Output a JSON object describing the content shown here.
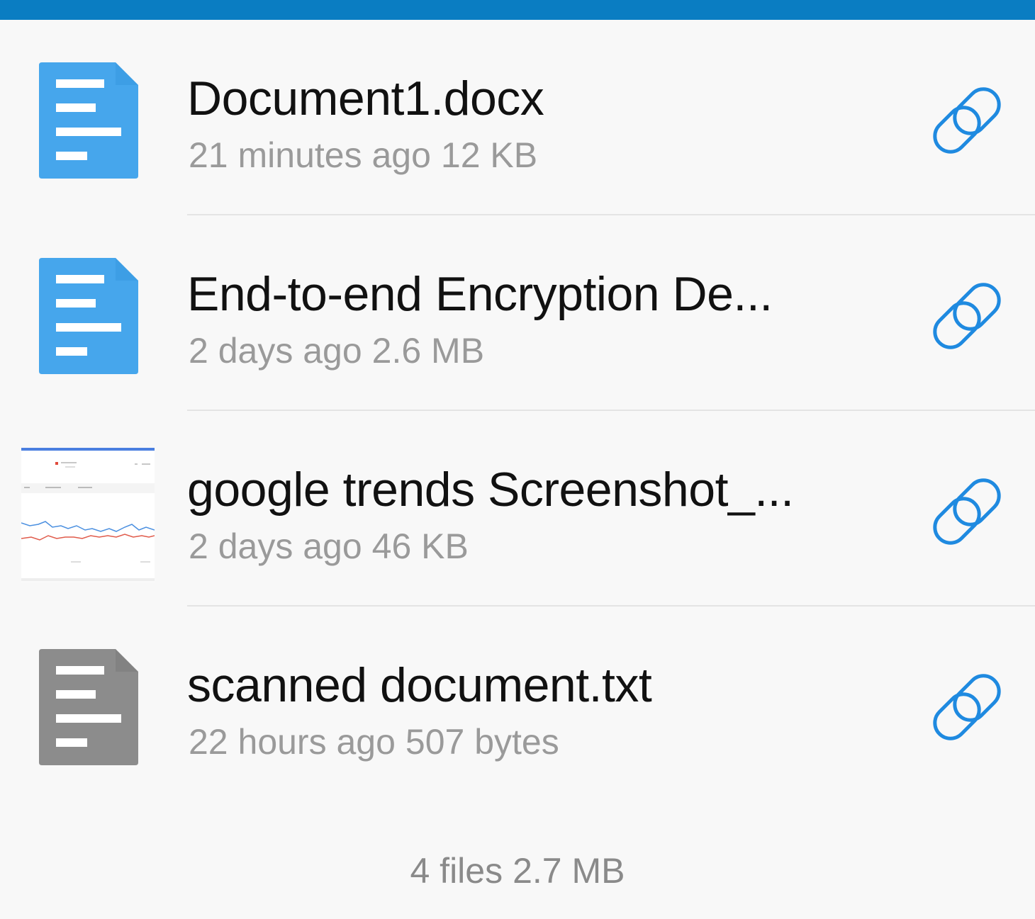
{
  "colors": {
    "accent": "#0a7dc2",
    "doc_icon": "#46a6ec",
    "txt_icon": "#8c8c8c",
    "link_icon": "#1f8ae0"
  },
  "files": [
    {
      "name": "Document1.docx",
      "modified": "21 minutes ago",
      "size": "12 KB",
      "icon": "document-icon"
    },
    {
      "name": "End-to-end Encryption De...",
      "modified": "2 days ago",
      "size": "2.6 MB",
      "icon": "document-icon"
    },
    {
      "name": "google trends Screenshot_...",
      "modified": "2 days ago",
      "size": "46 KB",
      "icon": "image-thumbnail"
    },
    {
      "name": "scanned document.txt",
      "modified": "22 hours ago",
      "size": "507 bytes",
      "icon": "text-file-icon"
    }
  ],
  "footer": {
    "count": "4 files",
    "total_size": "2.7 MB"
  }
}
